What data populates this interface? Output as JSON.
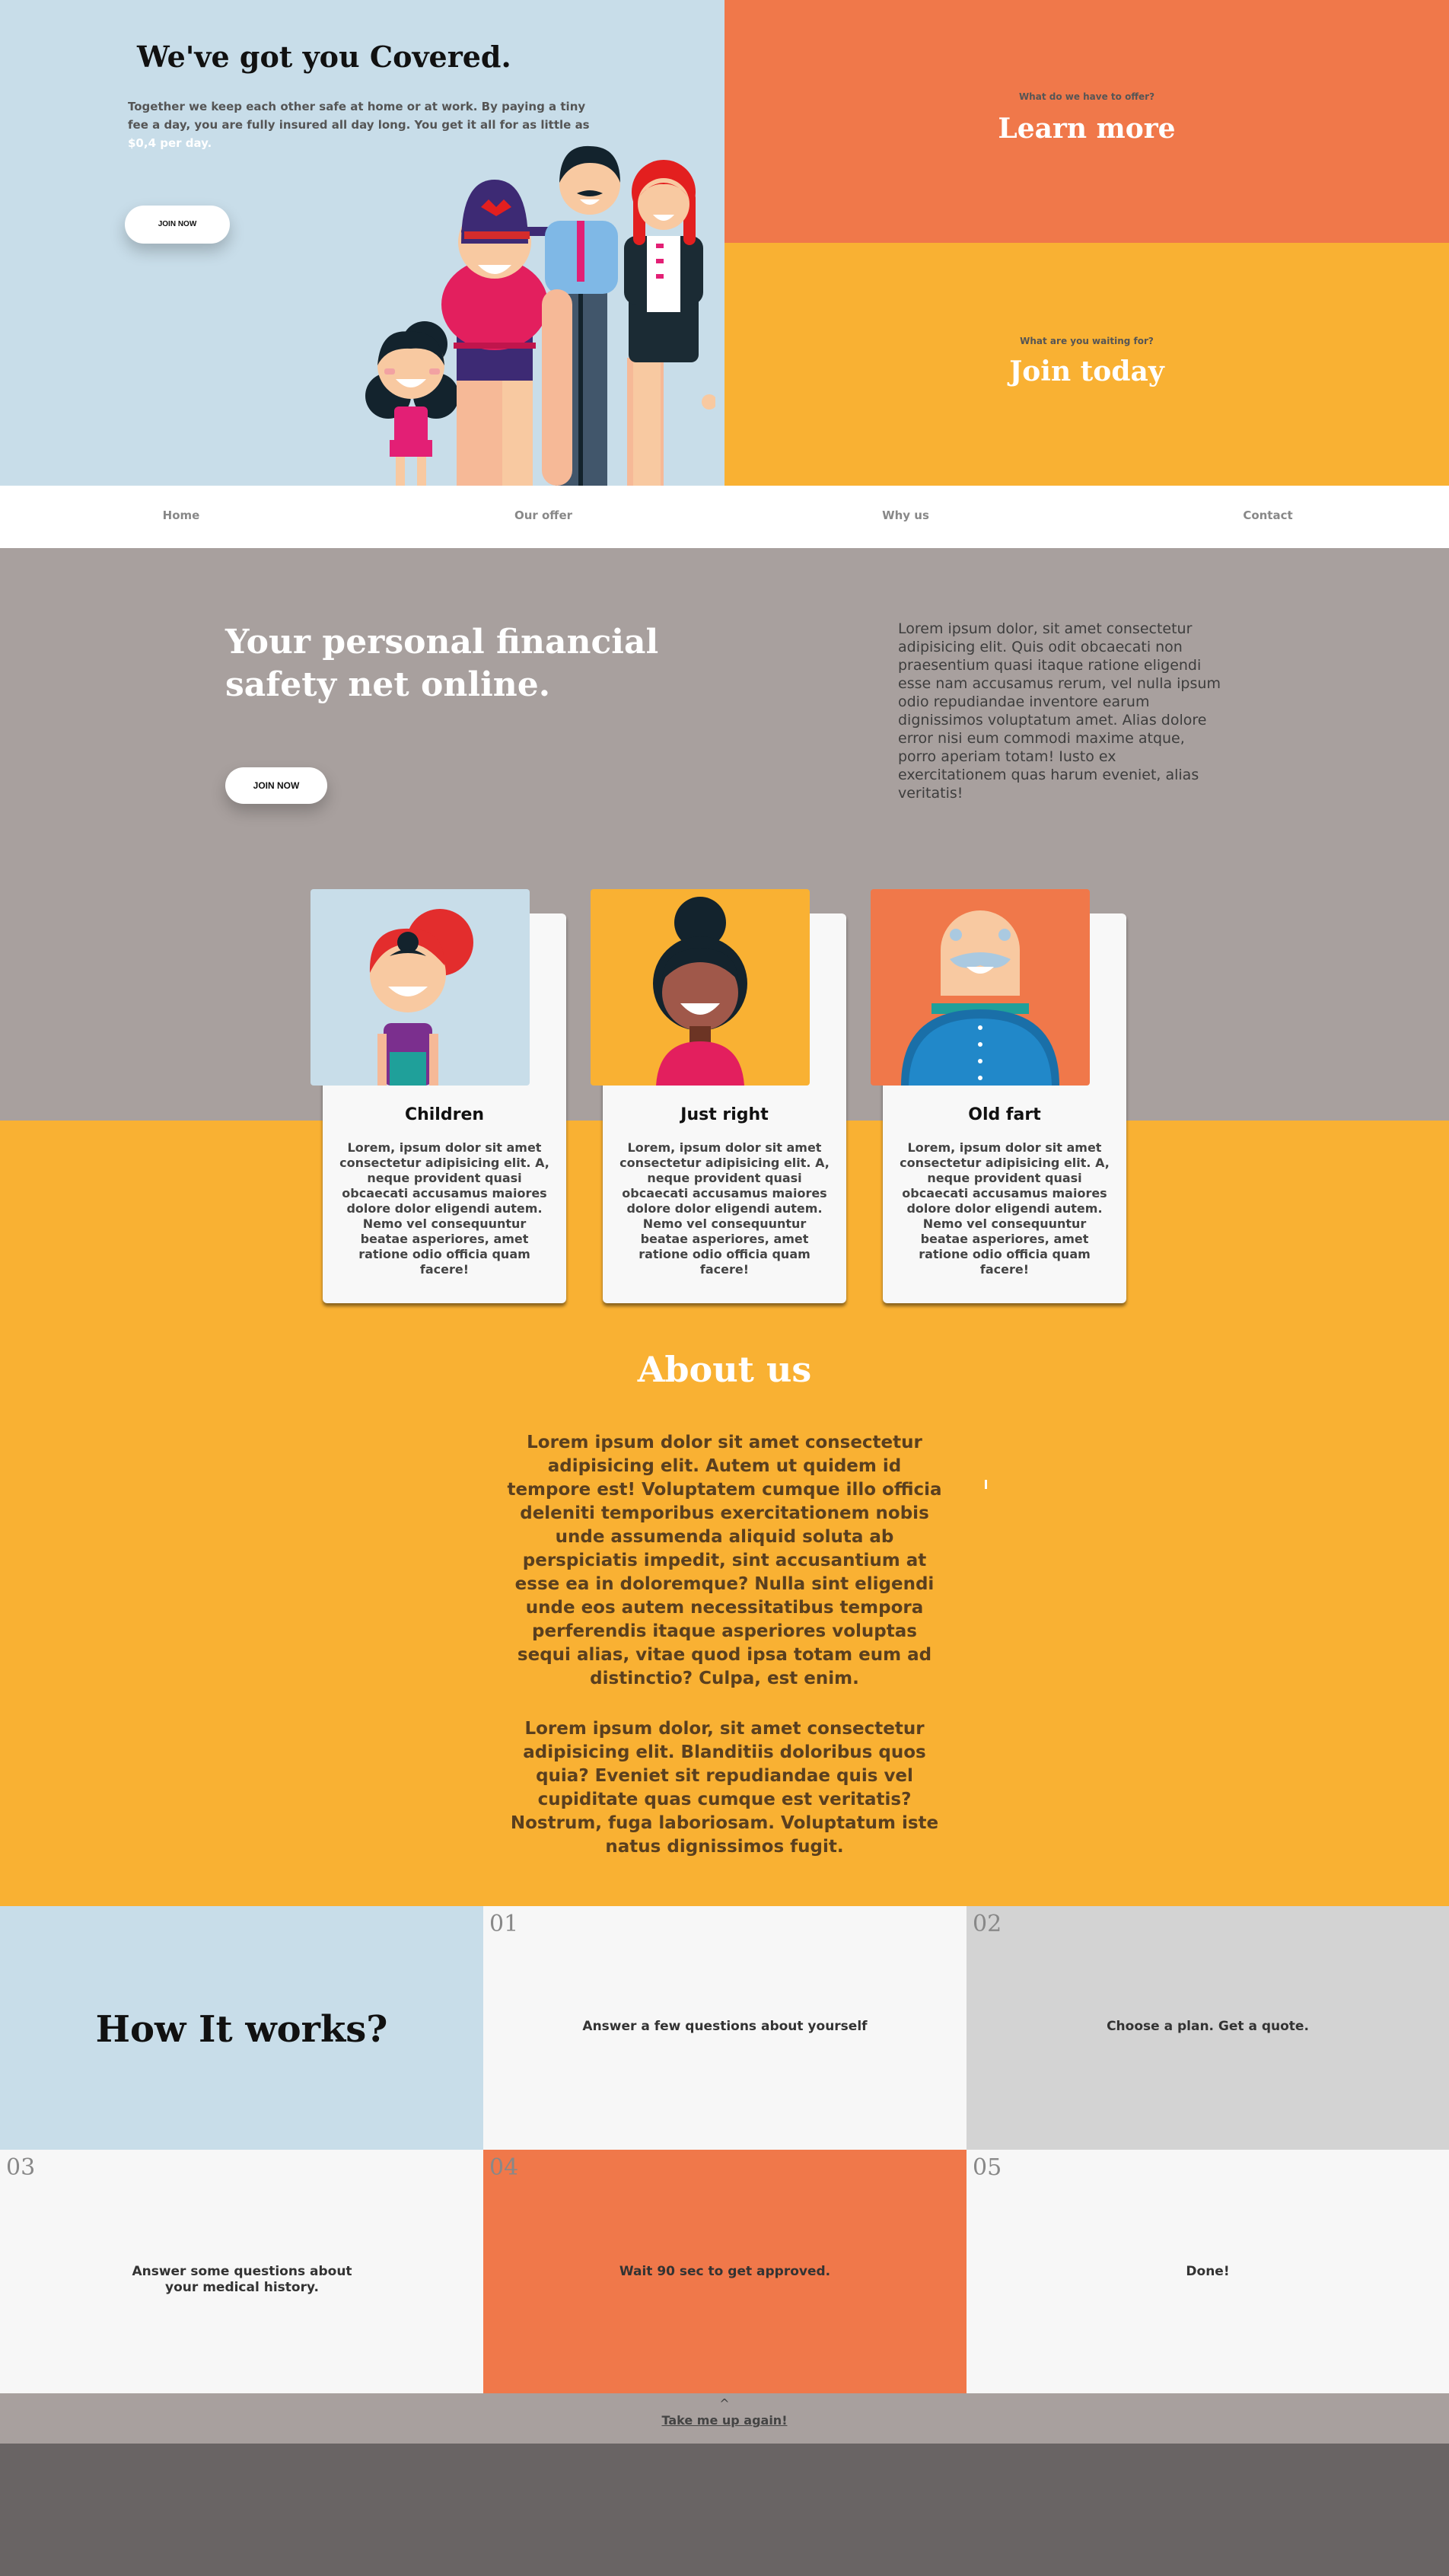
{
  "hero": {
    "title": "We've got you Covered.",
    "text_before": "Together we keep each other safe at home or at work. By paying a tiny fee a day, you are fully insured all day long. You get it all for as little as ",
    "text_highlight": "$0,4 per day.",
    "join_label": "JOIN NOW"
  },
  "offer": {
    "subtitle": "What do we have to offer?",
    "title": "Learn more"
  },
  "join_today": {
    "subtitle": "What are you waiting for?",
    "title": "Join today"
  },
  "nav": {
    "items": [
      "Home",
      "Our offer",
      "Why us",
      "Contact"
    ]
  },
  "safety": {
    "title": "Your personal financial safety net online.",
    "join_label": "JOIN NOW",
    "text": "Lorem ipsum dolor, sit amet consectetur adipisicing elit. Quis odit obcaecati non praesentium quasi itaque ratione eligendi esse nam accusamus rerum, vel nulla ipsum odio repudiandae inventore earum dignissimos voluptatum amet. Alias dolore error nisi eum commodi maxime atque, porro aperiam totam! Iusto ex exercitationem quas harum eveniet, alias veritatis!"
  },
  "cards": [
    {
      "title": "Children",
      "text": "Lorem, ipsum dolor sit amet consectetur adipisicing elit. A, neque provident quasi obcaecati accusamus maiores dolore dolor eligendi autem. Nemo vel consequuntur beatae asperiores, amet ratione odio officia quam facere!",
      "bg": "#c8dde9"
    },
    {
      "title": "Just right",
      "text": "Lorem, ipsum dolor sit amet consectetur adipisicing elit. A, neque provident quasi obcaecati accusamus maiores dolore dolor eligendi autem. Nemo vel consequuntur beatae asperiores, amet ratione odio officia quam facere!",
      "bg": "#f9b133"
    },
    {
      "title": "Old fart",
      "text": "Lorem, ipsum dolor sit amet consectetur adipisicing elit. A, neque provident quasi obcaecati accusamus maiores dolore dolor eligendi autem. Nemo vel consequuntur beatae asperiores, amet ratione odio officia quam facere!",
      "bg": "#f0784a"
    }
  ],
  "about": {
    "title": "About us",
    "p1": "Lorem ipsum dolor sit amet consectetur adipisicing elit. Autem ut quidem id tempore est! Voluptatem cumque illo officia deleniti temporibus exercitationem nobis unde assumenda aliquid soluta ab perspiciatis impedit, sint accusantium at esse ea in doloremque? Nulla sint eligendi unde eos autem necessitatibus tempora perferendis itaque asperiores voluptas sequi alias, vitae quod ipsa totam eum ad distinctio? Culpa, est enim.",
    "p2": "Lorem ipsum dolor, sit amet consectetur adipisicing elit. Blanditiis doloribus quos quia? Eveniet sit repudiandae quis vel cupiditate quas cumque est veritatis? Nostrum, fuga laboriosam. Voluptatum iste natus dignissimos fugit."
  },
  "how": {
    "title": "How It works?",
    "steps": [
      {
        "num": "01",
        "text": "Answer a few questions about yourself"
      },
      {
        "num": "02",
        "text": "Choose a plan. Get a quote."
      },
      {
        "num": "03",
        "text": "Answer some questions about your medical history."
      },
      {
        "num": "04",
        "text": "Wait 90 sec to get approved."
      },
      {
        "num": "05",
        "text": "Done!"
      }
    ]
  },
  "back_to_top": {
    "caret": "^",
    "label": "Take me up again!"
  },
  "colors": {
    "light_blue": "#c8dde9",
    "orange": "#f0784a",
    "yellow": "#f9b133",
    "taupe": "#a8a09e",
    "dark": "#696464"
  },
  "icons": [
    "family-illustration",
    "child-avatar",
    "adult-avatar",
    "senior-avatar"
  ]
}
